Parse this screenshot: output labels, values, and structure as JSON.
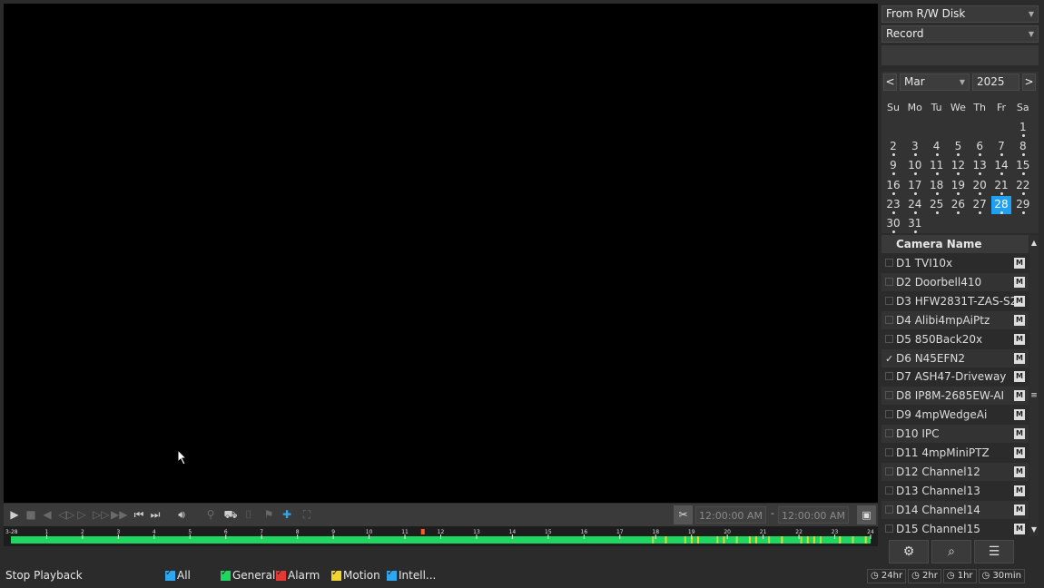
{
  "source": {
    "disk": "From R/W Disk",
    "type": "Record"
  },
  "calendar": {
    "prev": "<",
    "next": ">",
    "month": "Mar",
    "year": "2025",
    "weekdays": [
      "Su",
      "Mo",
      "Tu",
      "We",
      "Th",
      "Fr",
      "Sa"
    ],
    "days": [
      "1",
      "2",
      "3",
      "4",
      "5",
      "6",
      "7",
      "8",
      "9",
      "10",
      "11",
      "12",
      "13",
      "14",
      "15",
      "16",
      "17",
      "18",
      "19",
      "20",
      "21",
      "22",
      "23",
      "24",
      "25",
      "26",
      "27",
      "28",
      "29",
      "30",
      "31"
    ],
    "selected_day": "28",
    "first_weekday_index": 6
  },
  "cameras": {
    "header": "Camera Name",
    "items": [
      {
        "label": "D1 TVI10x",
        "checked": false
      },
      {
        "label": "D2 Doorbell410",
        "checked": false
      },
      {
        "label": "D3 HFW2831T-ZAS-S2",
        "checked": false
      },
      {
        "label": "D4 Alibi4mpAiPtz",
        "checked": false
      },
      {
        "label": "D5 850Back20x",
        "checked": false
      },
      {
        "label": "D6 N45EFN2",
        "checked": true
      },
      {
        "label": "D7 ASH47-Driveway",
        "checked": false
      },
      {
        "label": "D8 IP8M-2685EW-AI",
        "checked": false
      },
      {
        "label": "D9 4mpWedgeAi",
        "checked": false
      },
      {
        "label": "D10 IPC",
        "checked": false
      },
      {
        "label": "D11 4mpMiniPTZ",
        "checked": false
      },
      {
        "label": "D12 Channel12",
        "checked": false
      },
      {
        "label": "D13 Channel13",
        "checked": false
      },
      {
        "label": "D14 Channel14",
        "checked": false
      },
      {
        "label": "D15 Channel15",
        "checked": false
      }
    ],
    "m_label": "M"
  },
  "controls": {
    "start_time": "12:00:00 AM",
    "end_time": "12:00:00 AM",
    "dash": "-"
  },
  "timeline": {
    "start_label": "3-28",
    "hours": [
      "1",
      "2",
      "3",
      "4",
      "5",
      "6",
      "7",
      "8",
      "9",
      "10",
      "11",
      "12",
      "13",
      "14",
      "15",
      "16",
      "17",
      "18",
      "19",
      "20",
      "21",
      "22",
      "23",
      "24"
    ],
    "cursor_hour": 11.5
  },
  "bottom": {
    "stop": "Stop Playback",
    "filters": [
      {
        "label": "All",
        "color": "#2ea7f0"
      },
      {
        "label": "General",
        "color": "#1ed760"
      },
      {
        "label": "Alarm",
        "color": "#e53935"
      },
      {
        "label": "Motion",
        "color": "#f2d22e"
      },
      {
        "label": "Intell...",
        "color": "#2ea7f0"
      }
    ],
    "zoom": [
      "24hr",
      "2hr",
      "1hr",
      "30min"
    ]
  },
  "colors": {
    "general": "#1ed760",
    "motion": "#f2d22e",
    "selected": "#1ea1f0"
  }
}
